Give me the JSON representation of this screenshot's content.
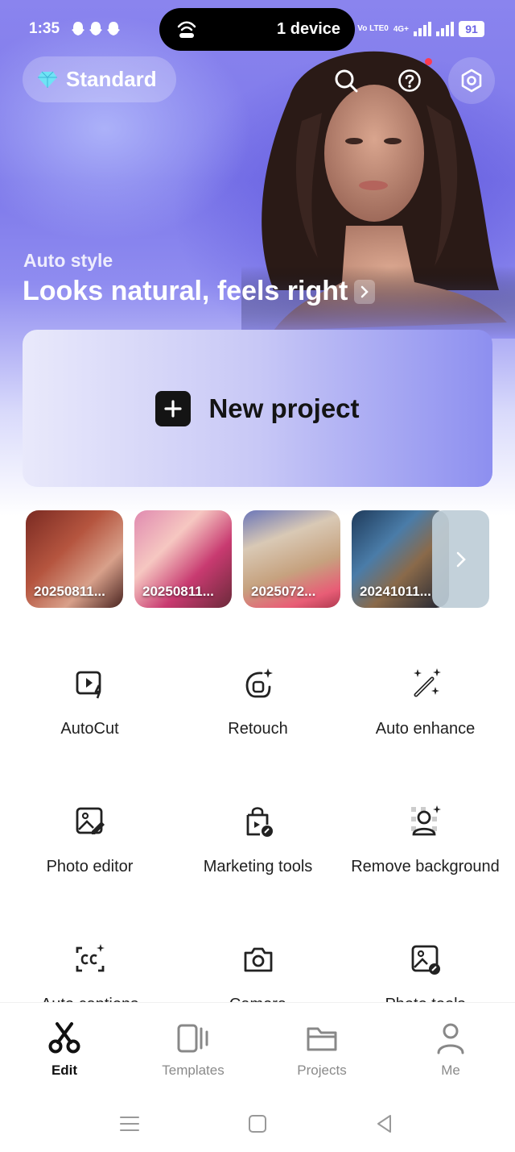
{
  "status_bar": {
    "time": "1:35",
    "dynamic_island_text": "1 device",
    "network_label": "Vo LTE0",
    "network_gen": "4G+",
    "battery": "91"
  },
  "header": {
    "plan_label": "Standard"
  },
  "hero": {
    "subtitle": "Auto style",
    "title": "Looks natural, feels right"
  },
  "new_project": {
    "label": "New project"
  },
  "recent_media": [
    {
      "label": "20250811..."
    },
    {
      "label": "20250811..."
    },
    {
      "label": "2025072..."
    },
    {
      "label": "20241011..."
    }
  ],
  "tools": [
    {
      "label": "AutoCut",
      "icon": "video-lightning-icon"
    },
    {
      "label": "Retouch",
      "icon": "face-sparkle-icon"
    },
    {
      "label": "Auto enhance",
      "icon": "magic-wand-icon"
    },
    {
      "label": "Photo editor",
      "icon": "photo-edit-icon"
    },
    {
      "label": "Marketing tools",
      "icon": "shopping-bag-icon"
    },
    {
      "label": "Remove background",
      "icon": "person-cutout-icon"
    },
    {
      "label": "Auto captions",
      "icon": "captions-icon"
    },
    {
      "label": "Camera",
      "icon": "camera-icon"
    },
    {
      "label": "Photo tools",
      "icon": "photo-tools-icon"
    }
  ],
  "bottom_nav": [
    {
      "label": "Edit",
      "icon": "scissors-icon",
      "active": true
    },
    {
      "label": "Templates",
      "icon": "templates-icon",
      "active": false
    },
    {
      "label": "Projects",
      "icon": "folder-icon",
      "active": false
    },
    {
      "label": "Me",
      "icon": "person-icon",
      "active": false
    }
  ],
  "colors": {
    "hero_purple": "#7d78ea",
    "accent_red": "#ff3b4f",
    "text_dark": "#141414"
  }
}
